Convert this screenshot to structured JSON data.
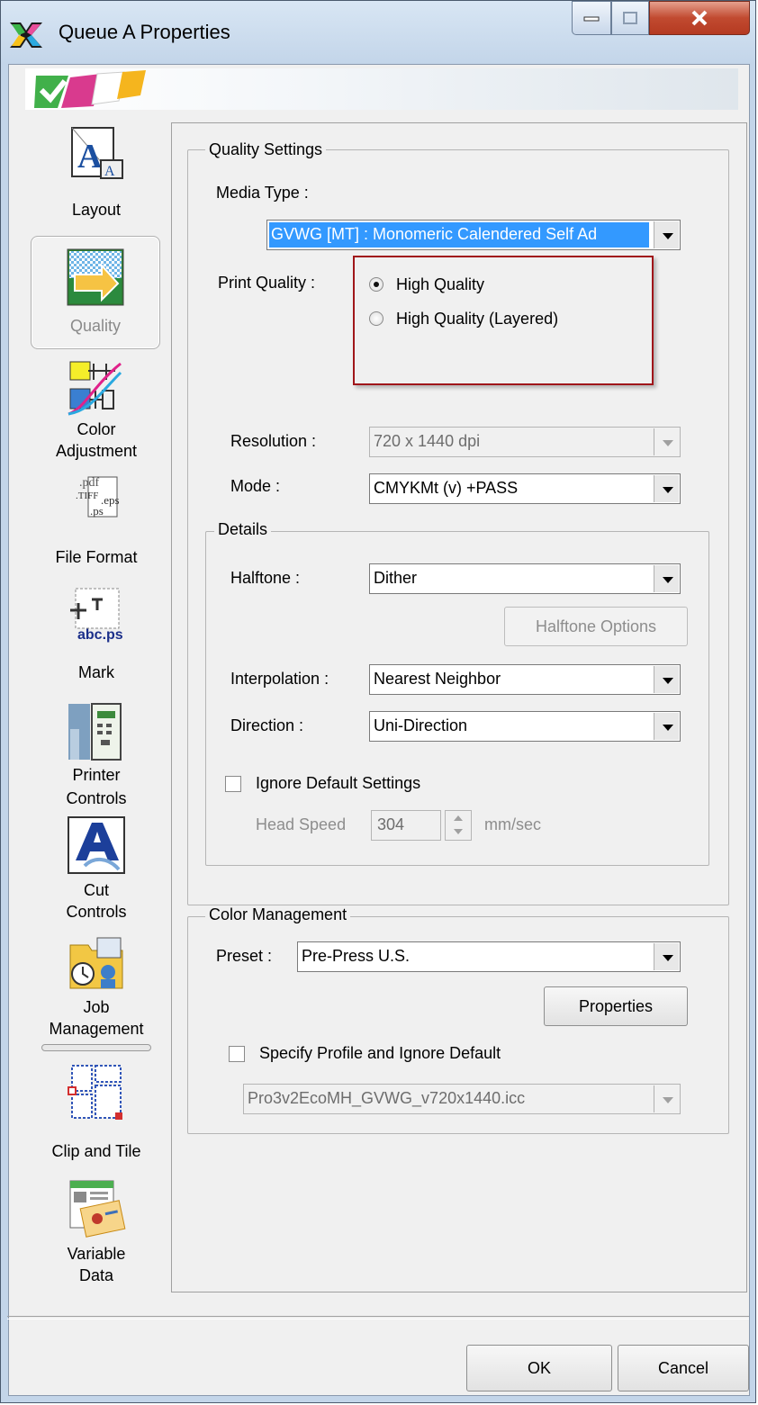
{
  "window": {
    "title": "Queue A Properties"
  },
  "nav": {
    "items": [
      {
        "label": "Layout",
        "icon": "layout-icon"
      },
      {
        "label": "Quality",
        "icon": "quality-icon"
      },
      {
        "label_line1": "Color",
        "label_line2": "Adjustment",
        "icon": "color-adjustment-icon"
      },
      {
        "label": "File Format",
        "icon": "file-format-icon"
      },
      {
        "label": "Mark",
        "icon": "mark-icon"
      },
      {
        "label_line1": "Printer",
        "label_line2": "Controls",
        "icon": "printer-controls-icon"
      },
      {
        "label_line1": "Cut",
        "label_line2": "Controls",
        "icon": "cut-controls-icon"
      },
      {
        "label_line1": "Job",
        "label_line2": "Management",
        "icon": "job-management-icon"
      },
      {
        "label": "Clip and Tile",
        "icon": "clip-tile-icon"
      },
      {
        "label_line1": "Variable",
        "label_line2": "Data",
        "icon": "variable-data-icon"
      }
    ],
    "selected": "Quality"
  },
  "quality": {
    "group_title": "Quality Settings",
    "media_type_label": "Media Type :",
    "media_type_value": "GVWG [MT] : Monomeric Calendered Self Ad",
    "print_quality_label": "Print Quality :",
    "print_quality_options": [
      "High Quality",
      "High Quality (Layered)"
    ],
    "print_quality_selected": "High Quality",
    "resolution_label": "Resolution :",
    "resolution_value": "720 x 1440 dpi",
    "mode_label": "Mode :",
    "mode_value": "CMYKMt (v) +PASS"
  },
  "details": {
    "group_title": "Details",
    "halftone_label": "Halftone :",
    "halftone_value": "Dither",
    "halftone_options_button": "Halftone Options",
    "interpolation_label": "Interpolation :",
    "interpolation_value": "Nearest Neighbor",
    "direction_label": "Direction :",
    "direction_value": "Uni-Direction",
    "ignore_default_label": "Ignore Default Settings",
    "ignore_default_checked": false,
    "head_speed_label": "Head Speed",
    "head_speed_value": "304",
    "head_speed_unit": "mm/sec"
  },
  "color_management": {
    "group_title": "Color Management",
    "preset_label": "Preset :",
    "preset_value": "Pre-Press U.S.",
    "properties_button": "Properties",
    "specify_profile_label": "Specify Profile and Ignore Default",
    "specify_profile_checked": false,
    "profile_value": "Pro3v2EcoMH_GVWG_v720x1440.icc"
  },
  "footer": {
    "ok_label": "OK",
    "cancel_label": "Cancel"
  },
  "colors": {
    "highlight": "#3399ff",
    "annotation": "#a0161a"
  }
}
